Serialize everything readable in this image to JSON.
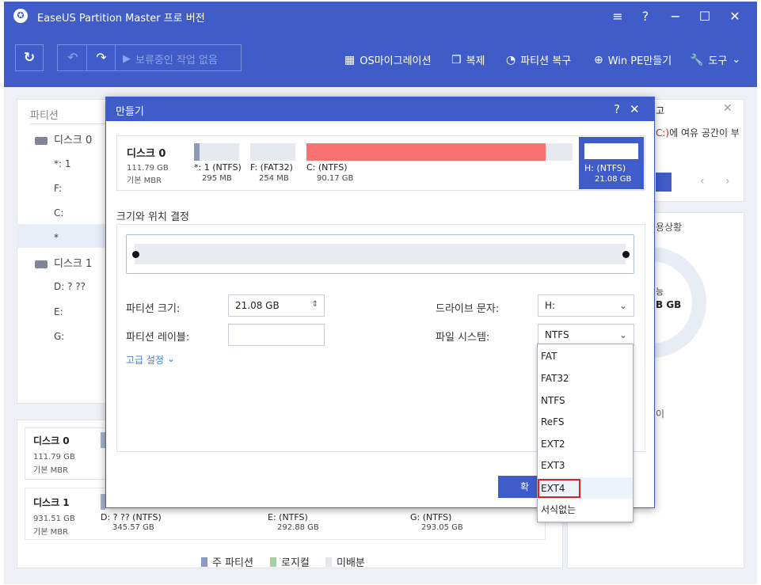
{
  "app": {
    "title": "EaseUS Partition Master 프로 버전"
  },
  "toolbar": {
    "pending": "보류중인 작업 없음",
    "menu": [
      {
        "label": "OS마이그레이션",
        "icon": "grid-icon"
      },
      {
        "label": "복제",
        "icon": "copy-icon"
      },
      {
        "label": "파티션 복구",
        "icon": "pie-icon"
      },
      {
        "label": "Win PE만들기",
        "icon": "plus-circle-icon"
      },
      {
        "label": "도구",
        "icon": "wrench-icon"
      }
    ]
  },
  "sidebar": {
    "header": "파티션",
    "disk0": {
      "label": "디스크 0",
      "parts": [
        "*: 1",
        "F:",
        "C:",
        "*"
      ]
    },
    "disk1": {
      "label": "디스크 1",
      "parts": [
        "D: ? ??",
        "E:",
        "G:"
      ]
    }
  },
  "right_panel": {
    "title_fragment": "고",
    "text_c": "C:)",
    "text_rest": "에 여유 공간이 부",
    "usage": "용상황",
    "gb": "B GB",
    "side_char": "이",
    "ring_char": "능"
  },
  "bottom": {
    "disk0": {
      "name": "디스크 0",
      "size": "111.79 GB",
      "type": "기본 MBR"
    },
    "disk1": {
      "name": "디스크 1",
      "size": "931.51 GB",
      "type": "기본 MBR",
      "parts": [
        {
          "label": "D: ? ?? (NTFS)",
          "size": "345.57 GB"
        },
        {
          "label": "E: (NTFS)",
          "size": "292.88 GB"
        },
        {
          "label": "G: (NTFS)",
          "size": "293.05 GB"
        }
      ]
    },
    "legend": [
      "주 파티션",
      "로지컬",
      "미배분"
    ]
  },
  "dialog": {
    "title": "만들기",
    "disk": {
      "name": "디스크 0",
      "size": "111.79 GB",
      "type": "기본 MBR"
    },
    "partitions": [
      {
        "label": "*: 1 (NTFS)",
        "size": "295 MB",
        "fill": 0.12
      },
      {
        "label": "F: (FAT32)",
        "size": "254 MB",
        "fill": 0.0
      },
      {
        "label": "C: (NTFS)",
        "size": "90.17 GB",
        "fill": 0.9
      },
      {
        "label": "H: (NTFS)",
        "size": "21.08 GB",
        "fill": 0.0
      }
    ],
    "section": "크기와 위치 결정",
    "size_label": "파티션 크기:",
    "size_value": "21.08 GB",
    "label_label": "파티션 레이블:",
    "drive_label": "드라이브 문자:",
    "drive_value": "H:",
    "fs_label": "파일 시스템:",
    "fs_value": "NTFS",
    "advanced": "고급 설정",
    "ok": "확",
    "fs_options": [
      "FAT",
      "FAT32",
      "NTFS",
      "ReFS",
      "EXT2",
      "EXT3",
      "EXT4",
      "서식없는"
    ]
  },
  "colors": {
    "accent": "#3f5cc9",
    "c_partition": "#f87171"
  }
}
